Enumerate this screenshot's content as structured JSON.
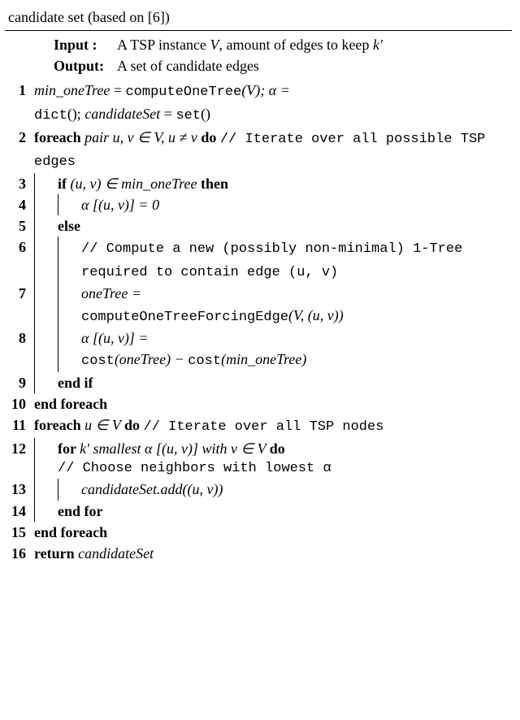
{
  "caption": "candidate set (based on [6])",
  "io": {
    "input_label": "Input  :",
    "input_text": "A TSP instance V, amount of edges to keep k′",
    "output_label": "Output:",
    "output_text": "A set of candidate edges"
  },
  "lines": {
    "l1_a": "min_oneTree",
    "l1_b": " = ",
    "l1_c": "computeOneTree",
    "l1_d": "(V); α =",
    "l1_e": "dict",
    "l1_f": "(); ",
    "l1_g": "candidateSet",
    "l1_h": " = ",
    "l1_i": "set",
    "l1_j": "()",
    "l2_a": "foreach ",
    "l2_b": "pair u, v ∈ V, u ≠ v ",
    "l2_c": "do ",
    "l2_d": "// Iterate over all possible TSP edges",
    "l3_a": "if ",
    "l3_b": "(u, v) ∈ min_oneTree ",
    "l3_c": "then",
    "l4": "α [(u, v)] = 0",
    "l5": "else",
    "l6": "// Compute a new (possibly non-minimal) 1-Tree required to contain edge (u, v)",
    "l7_a": "oneTree =",
    "l7_b": "computeOneTreeForcingEdge",
    "l7_c": "(V, (u, v))",
    "l8_a": "α [(u, v)] =",
    "l8_b": "cost",
    "l8_c": "(oneTree) − ",
    "l8_d": "cost",
    "l8_e": "(min_oneTree)",
    "l9": "end if",
    "l10": "end foreach",
    "l11_a": "foreach ",
    "l11_b": "u ∈ V ",
    "l11_c": "do ",
    "l11_d": "// Iterate over all TSP nodes",
    "l12_a": "for ",
    "l12_b": "k' smallest α [(u, v)] with v ∈ V ",
    "l12_c": "do",
    "l12_d": "// Choose neighbors with lowest α",
    "l13_a": "candidateSet.add",
    "l13_b": "((u, v))",
    "l14": "end for",
    "l15": "end foreach",
    "l16_a": "return ",
    "l16_b": "candidateSet"
  }
}
